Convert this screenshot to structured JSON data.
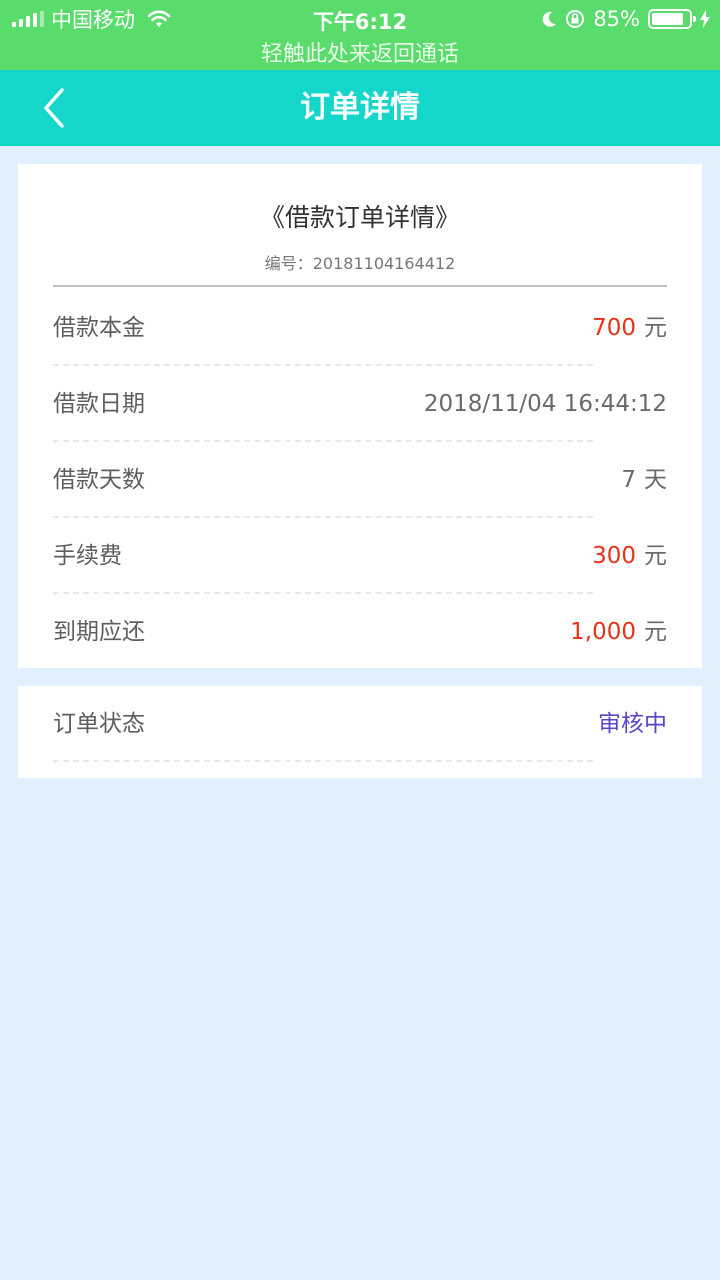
{
  "status_bar": {
    "carrier": "中国移动",
    "time": "下午6:12",
    "battery": "85%",
    "battery_level": 0.85,
    "icons": [
      "signal-icon",
      "wifi-icon",
      "moon-icon",
      "rotation-lock-icon",
      "battery-icon",
      "charging-icon"
    ]
  },
  "call_banner": "轻触此处来返回通话",
  "nav": {
    "title": "订单详情",
    "back_icon": "chevron-left-icon"
  },
  "colors": {
    "status_bar": "#59dc6c",
    "nav_bar": "#14d7ca",
    "background": "#e2f0fd",
    "amount_red": "#e8321a",
    "status_purple": "#5b45c9"
  },
  "order": {
    "title": "《借款订单详情》",
    "number": "编号：20181104164412",
    "rows": [
      {
        "label": "借款本金",
        "value": "700",
        "unit": "元"
      },
      {
        "label": "借款日期",
        "value": "2018/11/04 16:44:12"
      },
      {
        "label": "借款天数",
        "value": "7",
        "unit": "天"
      },
      {
        "label": "手续费",
        "value": "300",
        "unit": "元"
      },
      {
        "label": "到期应还",
        "value": "1,000",
        "unit": "元"
      }
    ]
  },
  "status": {
    "label": "订单状态",
    "value": "审核中"
  }
}
